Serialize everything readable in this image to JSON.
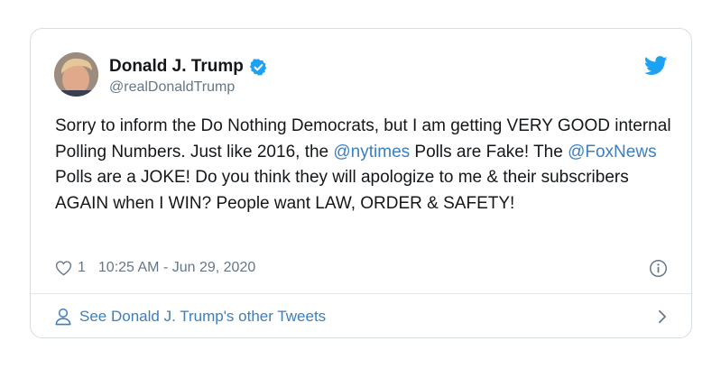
{
  "tweet": {
    "author_name": "Donald J. Trump",
    "author_handle": "@realDonaldTrump",
    "text_parts": {
      "p1": "Sorry to inform the Do Nothing Democrats, but I am getting VERY GOOD internal Polling Numbers. Just like 2016, the ",
      "mention1": "@nytimes",
      "p2": " Polls are Fake! The ",
      "mention2": "@FoxNews",
      "p3": " Polls are a JOKE! Do you think they will apologize to me & their subscribers AGAIN when I WIN? People want LAW, ORDER & SAFETY!"
    },
    "like_count": "1",
    "timestamp": "10:25 AM - Jun 29, 2020"
  },
  "footer": {
    "label": "See Donald J. Trump's other Tweets"
  },
  "icons": {
    "verified": "verified-badge-icon",
    "brand": "twitter-bird-icon",
    "like": "heart-icon",
    "info": "info-icon",
    "profile": "person-icon",
    "chevron": "chevron-right-icon"
  },
  "colors": {
    "link": "#3b7fbf",
    "text": "#14171a",
    "muted": "#657786",
    "twitter_blue": "#1da1f2",
    "border": "#d6dde3"
  }
}
